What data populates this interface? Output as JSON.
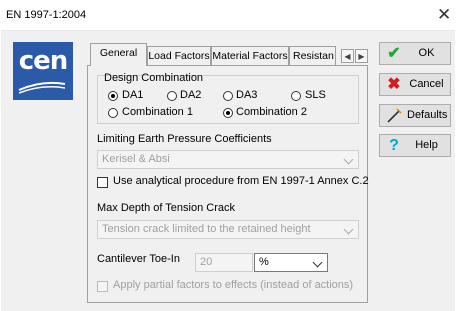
{
  "window": {
    "title": "EN 1997-1:2004"
  },
  "logo": {
    "text": "cen"
  },
  "tabs": [
    {
      "label": "General"
    },
    {
      "label": "Load Factors"
    },
    {
      "label": "Material Factors"
    },
    {
      "label": "Resistan"
    }
  ],
  "design_combination": {
    "title": "Design Combination",
    "options_row1": [
      "DA1",
      "DA2",
      "DA3",
      "SLS"
    ],
    "selected_row1": "DA1",
    "options_row2": [
      "Combination 1",
      "Combination 2"
    ],
    "selected_row2": "Combination 2"
  },
  "limiting_earth": {
    "title": "Limiting Earth Pressure Coefficients",
    "value": "Kerisel & Absi"
  },
  "analytical": {
    "label": "Use analytical procedure from EN 1997-1 Annex C.2",
    "checked": false
  },
  "tension_crack": {
    "title": "Max Depth of Tension Crack",
    "value": "Tension crack limited to the retained height"
  },
  "cantilever": {
    "label": "Cantilever Toe-In",
    "value": "20",
    "unit": "%"
  },
  "partial_factors": {
    "label": "Apply partial factors to effects (instead of actions)",
    "checked": false
  },
  "buttons": {
    "ok": "OK",
    "cancel": "Cancel",
    "defaults": "Defaults",
    "help": "Help"
  },
  "colors": {
    "logo_blue": "#2a5aa8",
    "ok_green": "#22a83a",
    "cancel_red": "#d21f1f",
    "help_cyan": "#00a6d6"
  }
}
